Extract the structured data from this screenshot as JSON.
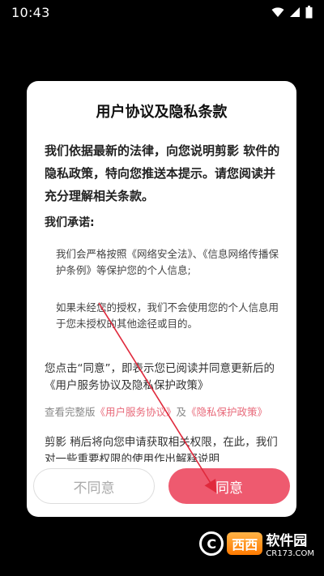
{
  "status": {
    "time": "10:43"
  },
  "dialog": {
    "title": "用户协议及隐私条款",
    "intro": "我们依据最新的法律，向您说明剪影 软件的隐私政策，特向您推送本提示。请您阅读并充分理解相关条款。",
    "promise_heading": "我们承诺:",
    "promise_1": "我们会严格按照《网络安全法》、《信息网络传播保护条例》等保护您的个人信息;",
    "promise_2": "如果未经您的授权，我们不会使用您的个人信息用于您未授权的其他途径或目的。",
    "consent": "您点击“同意”，即表示您已阅读并同意更新后的《用户服务协议及隐私保护政策》",
    "links_prefix": "查看完整版",
    "link_user_agreement": "《用户服务协议》",
    "links_and": "及",
    "link_privacy_policy": "《隐私保护政策》",
    "permission": "剪影 稍后将向您申请获取相关权限，在此，我们对一些重要权限的使用作出解释说明"
  },
  "buttons": {
    "disagree": "不同意",
    "agree": "同意"
  },
  "watermark": {
    "logo_letter": "C",
    "brand": "西西",
    "name": "软件园",
    "site": "CR173.COM"
  },
  "colors": {
    "accent": "#ee5a6f",
    "arrow": "#e0293c",
    "link": "#e86a7a"
  },
  "icons": [
    "wifi-icon",
    "signal-icon",
    "battery-icon"
  ]
}
